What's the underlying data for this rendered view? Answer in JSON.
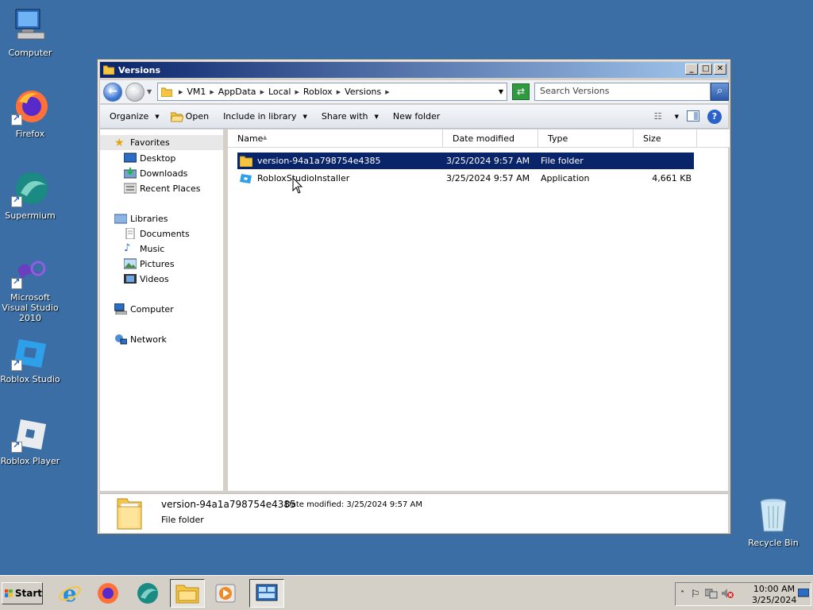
{
  "desktop": {
    "icons": [
      {
        "label": "Computer"
      },
      {
        "label": "Firefox"
      },
      {
        "label": "Supermium"
      },
      {
        "label": "Microsoft Visual Studio 2010"
      },
      {
        "label": "Roblox Studio"
      },
      {
        "label": "Roblox Player"
      },
      {
        "label": "Recycle Bin"
      }
    ]
  },
  "window": {
    "title": "Versions",
    "address": {
      "crumbs": [
        "VM1",
        "AppData",
        "Local",
        "Roblox",
        "Versions"
      ]
    },
    "search": {
      "placeholder": "Search Versions"
    },
    "toolbar": {
      "organize": "Organize",
      "open": "Open",
      "include_in_library": "Include in library",
      "share_with": "Share with",
      "new_folder": "New folder"
    },
    "nav": {
      "favorites": "Favorites",
      "desktop": "Desktop",
      "downloads": "Downloads",
      "recent_places": "Recent Places",
      "libraries": "Libraries",
      "documents": "Documents",
      "music": "Music",
      "pictures": "Pictures",
      "videos": "Videos",
      "computer": "Computer",
      "network": "Network"
    },
    "columns": {
      "name": "Name",
      "date_modified": "Date modified",
      "type": "Type",
      "size": "Size"
    },
    "files": [
      {
        "name": "version-94a1a798754e4385",
        "date": "3/25/2024 9:57 AM",
        "type": "File folder",
        "size": "",
        "selected": true
      },
      {
        "name": "RobloxStudioInstaller",
        "date": "3/25/2024 9:57 AM",
        "type": "Application",
        "size": "4,661 KB",
        "selected": false
      }
    ],
    "details": {
      "name": "version-94a1a798754e4385",
      "modified": "Date modified:  3/25/2024 9:57 AM",
      "type": "File folder"
    }
  },
  "taskbar": {
    "start": "Start",
    "clock_time": "10:00 AM",
    "clock_date": "3/25/2024"
  },
  "colors": {
    "desktop": "#3a6ea5",
    "selection": "#0a246a",
    "folder": "#f5c542"
  }
}
